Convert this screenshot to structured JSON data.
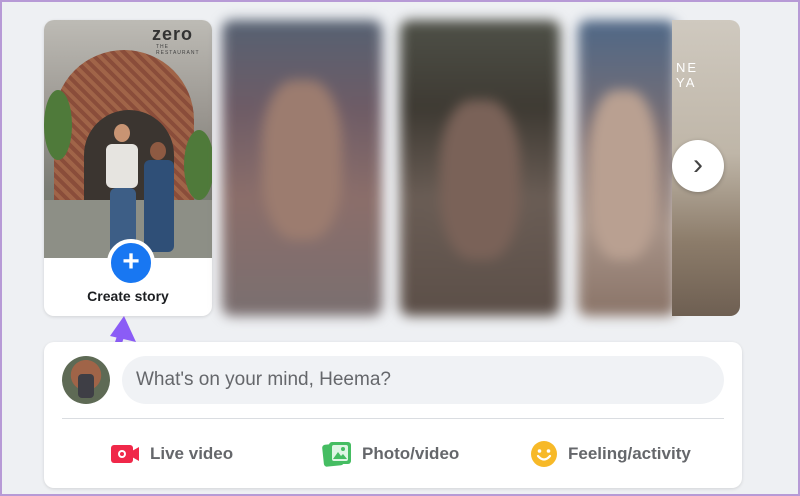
{
  "stories": {
    "create_label": "Create story",
    "plus_symbol": "+",
    "create_photo_sign": "zero",
    "create_photo_sign_sub": "THE RESTAURANT",
    "side_photo_text": "NE\nYA",
    "next_icon": "chevron-right-icon"
  },
  "composer": {
    "placeholder": "What's on your mind, Heema?",
    "actions": [
      {
        "label": "Live video",
        "icon": "live-video-icon",
        "color": "#f02849"
      },
      {
        "label": "Photo/video",
        "icon": "photo-video-icon",
        "color": "#45bd62"
      },
      {
        "label": "Feeling/activity",
        "icon": "feeling-icon",
        "color": "#f7b928"
      }
    ]
  },
  "annotation": {
    "arrow_color": "#8b5cf6"
  },
  "colors": {
    "accent": "#1877f2",
    "background": "#eef0f3"
  }
}
